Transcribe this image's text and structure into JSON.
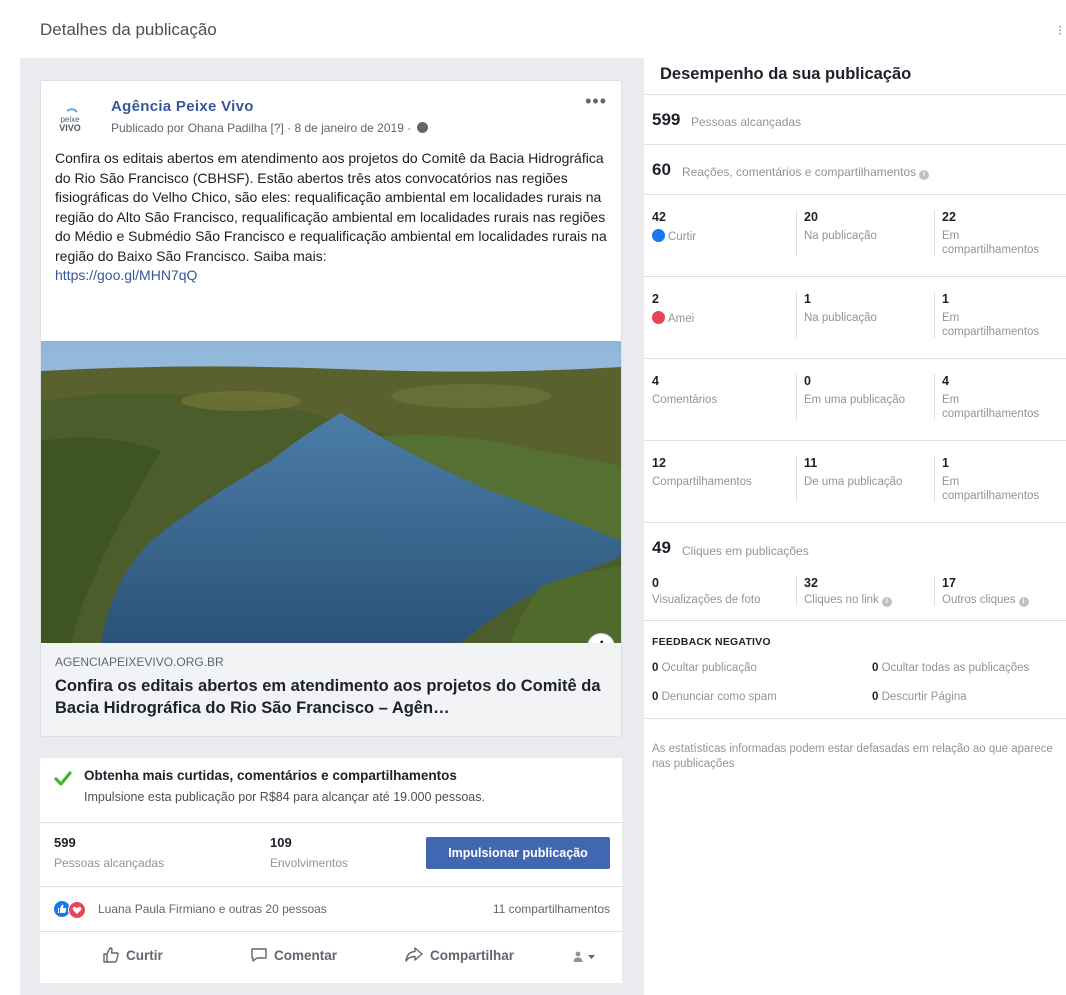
{
  "header": {
    "title": "Detalhes da publicação"
  },
  "post": {
    "page_name": "Agência Peixe Vivo",
    "published_by": "Publicado por Ohana Padilha [?] · 8 de janeiro de 2019 ·",
    "text": "Confira os editais abertos em atendimento aos projetos do Comitê da Bacia Hidrográfica do Rio São Francisco (CBHSF). Estão abertos três atos convocatórios nas regiões fisiográficas do Velho Chico, são eles: requalificação ambiental em localidades rurais na região do Alto São Francisco, requalificação ambiental em localidades rurais nas regiões do Médio e Submédio São Francisco e requalificação ambiental em localidades rurais na região do Baixo São Francisco. Saiba mais:",
    "link": "https://goo.gl/MHN7qQ",
    "link_domain": "AGENCIAPEIXEVIVO.ORG.BR",
    "link_title": "Confira os editais abertos em atendimento aos projetos do Comitê da Bacia Hidrográfica do Rio São Francisco – Agên…",
    "logo_text_1": "peixe",
    "logo_text_2": "VIVO"
  },
  "promo": {
    "title": "Obtenha mais curtidas, comentários e compartilhamentos",
    "subtitle": "Impulsione esta publicação por R$84 para alcançar até 19.000 pessoas."
  },
  "summary": {
    "reach_value": "599",
    "reach_label": "Pessoas alcançadas",
    "engagement_value": "109",
    "engagement_label": "Envolvimentos",
    "boost_label": "Impulsionar publicação",
    "reactors": "Luana Paula Firmiano e outras 20 pessoas",
    "shares": "11 compartilhamentos"
  },
  "actions": {
    "like": "Curtir",
    "comment": "Comentar",
    "share": "Compartilhar"
  },
  "performance": {
    "title": "Desempenho da sua publicação",
    "reach_value": "599",
    "reach_label": "Pessoas alcançadas",
    "reactions_value": "60",
    "reactions_label": "Reações, comentários e compartilhamentos",
    "rows": [
      {
        "v1": "42",
        "l1": "Curtir",
        "v2": "20",
        "l2": "Na publicação",
        "v3": "22",
        "l3": "Em compartilhamentos"
      },
      {
        "v1": "2",
        "l1": "Amei",
        "v2": "1",
        "l2": "Na publicação",
        "v3": "1",
        "l3": "Em compartilhamentos"
      },
      {
        "v1": "4",
        "l1": "Comentários",
        "v2": "0",
        "l2": "Em uma publicação",
        "v3": "4",
        "l3": "Em compartilhamentos"
      },
      {
        "v1": "12",
        "l1": "Compartilhamentos",
        "v2": "11",
        "l2": "De uma publicação",
        "v3": "1",
        "l3": "Em compartilhamentos"
      }
    ],
    "clicks_value": "49",
    "clicks_label": "Cliques em publicações",
    "clicks": {
      "v1": "0",
      "l1": "Visualizações de foto",
      "v2": "32",
      "l2": "Cliques no link",
      "v3": "17",
      "l3": "Outros cliques"
    },
    "negative_title": "FEEDBACK NEGATIVO",
    "negative": {
      "hide_post_value": "0",
      "hide_post_label": "Ocultar publicação",
      "hide_all_value": "0",
      "hide_all_label": "Ocultar todas as publicações",
      "spam_value": "0",
      "spam_label": "Denunciar como spam",
      "unlike_value": "0",
      "unlike_label": "Descurtir Página"
    },
    "disclaimer": "As estatísticas informadas podem estar defasadas em relação ao que aparece nas publicações"
  },
  "colors": {
    "brand": "#4267b2",
    "link": "#365899",
    "like": "#1877f2",
    "love": "#e9445a",
    "check": "#42b72a"
  },
  "icons": [
    "more-icon",
    "globe-icon",
    "info-icon",
    "check-icon",
    "like-reaction-icon",
    "love-reaction-icon",
    "thumbs-up-icon",
    "comment-icon",
    "share-icon",
    "audience-icon",
    "chevron-down-icon"
  ]
}
